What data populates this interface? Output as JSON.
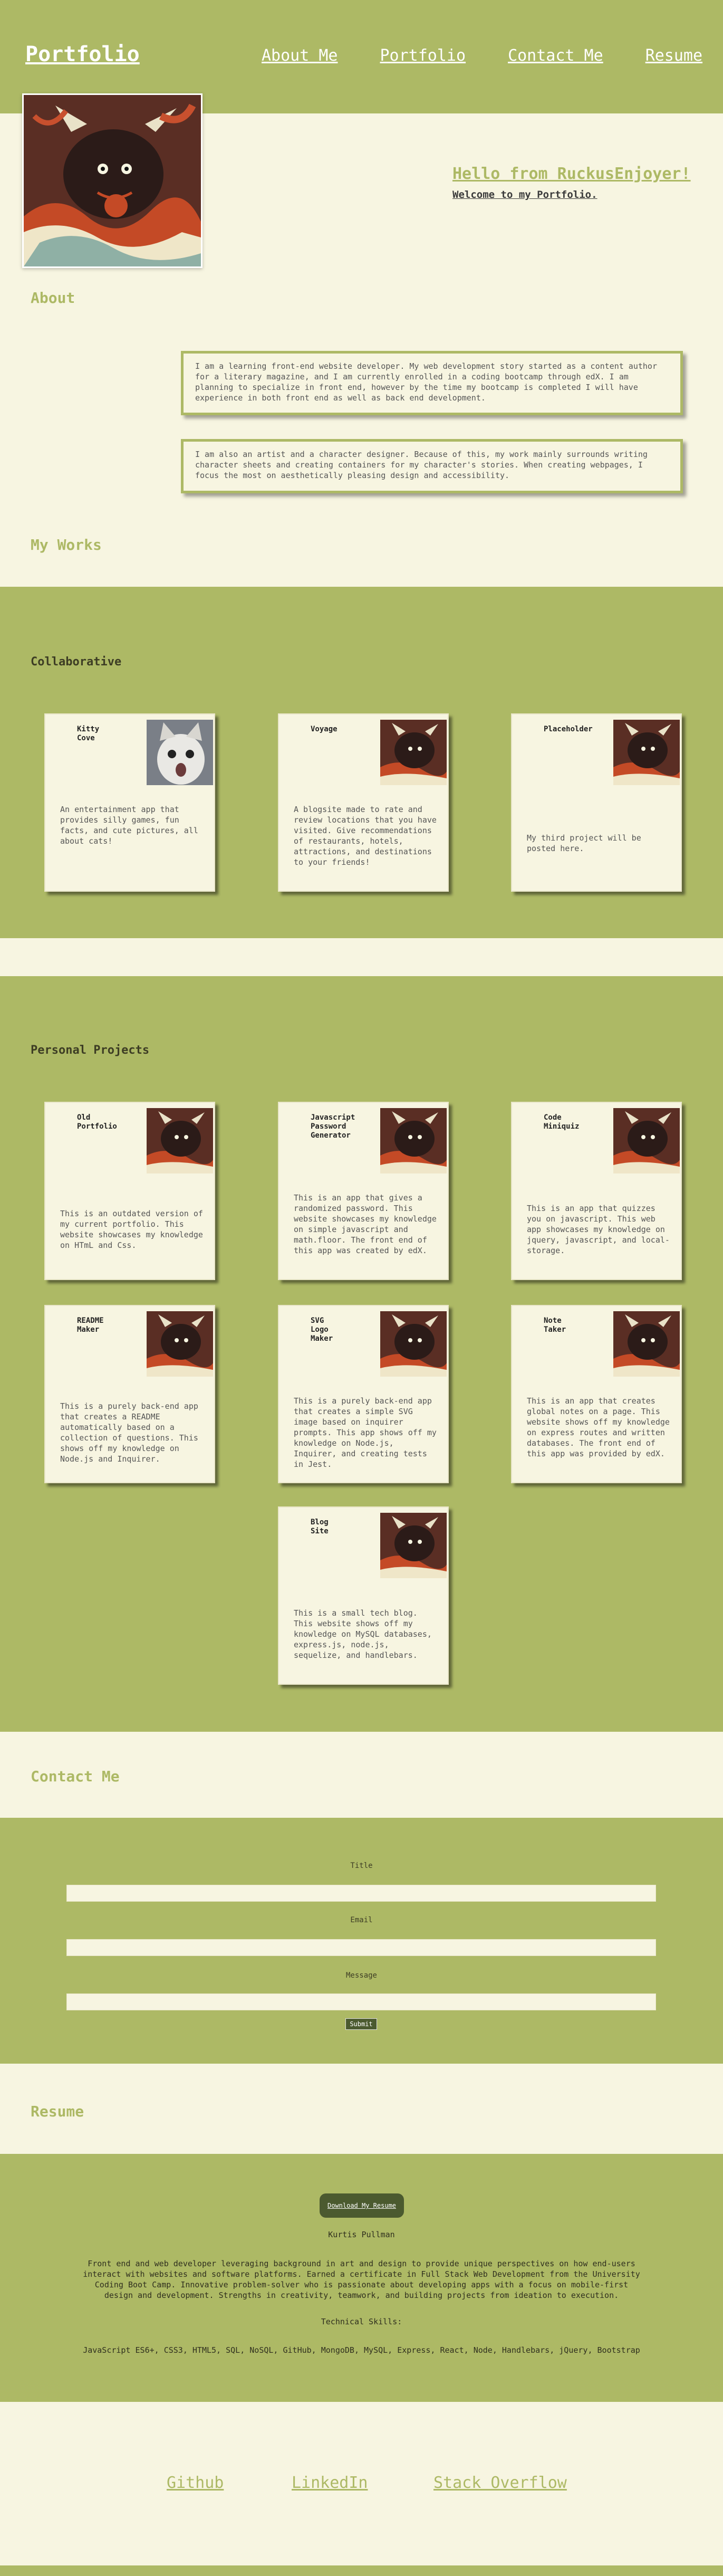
{
  "header": {
    "brand": "Portfolio",
    "nav": [
      "About Me",
      "Portfolio",
      "Contact Me",
      "Resume"
    ]
  },
  "hero": {
    "hello": "Hello from RuckusEnjoyer!",
    "welcome": "Welcome to my Portfolio."
  },
  "about": {
    "heading": "About",
    "paragraphs": [
      "I am a learning front-end website developer. My web development story started as a content author for a literary magazine, and I am currently enrolled in a coding bootcamp through edX. I am planning to specialize in front end, however by the time my bootcamp is completed I will have experience in both front end as well as back end development.",
      "I am also an artist and a character designer. Because of this, my work mainly surrounds writing character sheets and creating containers for my character's stories. When creating webpages, I focus the most on aesthetically pleasing design and accessibility."
    ]
  },
  "works": {
    "heading": "My Works",
    "collab_heading": "Collaborative",
    "collab": [
      {
        "title": "Kitty\nCove",
        "desc": "An entertainment app that provides silly games, fun facts, and cute pictures, all about cats!",
        "image": "cat-photo"
      },
      {
        "title": "Voyage",
        "desc": "A blogsite made to rate and review locations that you have visited. Give recommendations of restaurants, hotels, attractions, and destinations to your friends!",
        "image": "character-art"
      },
      {
        "title": "Placeholder",
        "desc": "My third project will be posted here.",
        "image": "character-art"
      }
    ],
    "personal_heading": "Personal Projects",
    "personal": [
      {
        "title": "Old\nPortfolio",
        "desc": "This is an outdated version of my current portfolio. This website showcases my knowledge on HTmL and Css."
      },
      {
        "title": "Javascript\nPassword\nGenerator",
        "desc": "This is an app that gives a randomized password. This website showcases my knowledge on simple javascript and math.floor. The front end of this app was created by edX."
      },
      {
        "title": "Code\nMiniquiz",
        "desc": "This is an app that quizzes you on javascript. This web app showcases my knowledge on jquery, javascript, and local-storage."
      },
      {
        "title": "README\nMaker",
        "desc": "This is a purely back-end app that creates a README automatically based on a collection of questions. This shows off my knowledge on Node.js and Inquirer."
      },
      {
        "title": "SVG\nLogo\nMaker",
        "desc": "This is a purely back-end app that creates a simple SVG image based on inquirer prompts. This app shows off my knowledge on Node.js, Inquirer, and creating tests in Jest."
      },
      {
        "title": "Note\nTaker",
        "desc": "This is an app that creates global notes on a page. This website shows off my knowledge on express routes and written databases. The front end of this app was provided by edX."
      },
      {
        "title": "Blog\nSite",
        "desc": "This is a small tech blog. This website shows off my knowledge on MySQL databases, express.js, node.js, sequelize, and handlebars."
      }
    ]
  },
  "contact": {
    "heading": "Contact Me",
    "labels": [
      "Title",
      "Email",
      "Message"
    ],
    "submit": "Submit"
  },
  "resume": {
    "heading": "Resume",
    "download": "Download My Resume",
    "name": "Kurtis Pullman",
    "summary": "Front end and web developer leveraging background in art and design to provide unique perspectives on how end-users interact with websites and software platforms. Earned a certificate in Full Stack Web Development from the University Coding Boot Camp. Innovative problem-solver who is passionate about developing apps with a focus on mobile-first design and development. Strengths in creativity, teamwork, and building projects from ideation to execution.",
    "skills_heading": "Technical Skills:",
    "skills": "JavaScript ES6+, CSS3, HTML5, SQL, NoSQL, GitHub, MongoDB, MySQL, Express, React, Node, Handlebars, jQuery, Bootstrap"
  },
  "footer": {
    "links": [
      "Github",
      "LinkedIn",
      "Stack Overflow"
    ]
  },
  "colors": {
    "accent": "#adb965",
    "background": "#f7f5e1",
    "button": "#4b5a2f"
  }
}
